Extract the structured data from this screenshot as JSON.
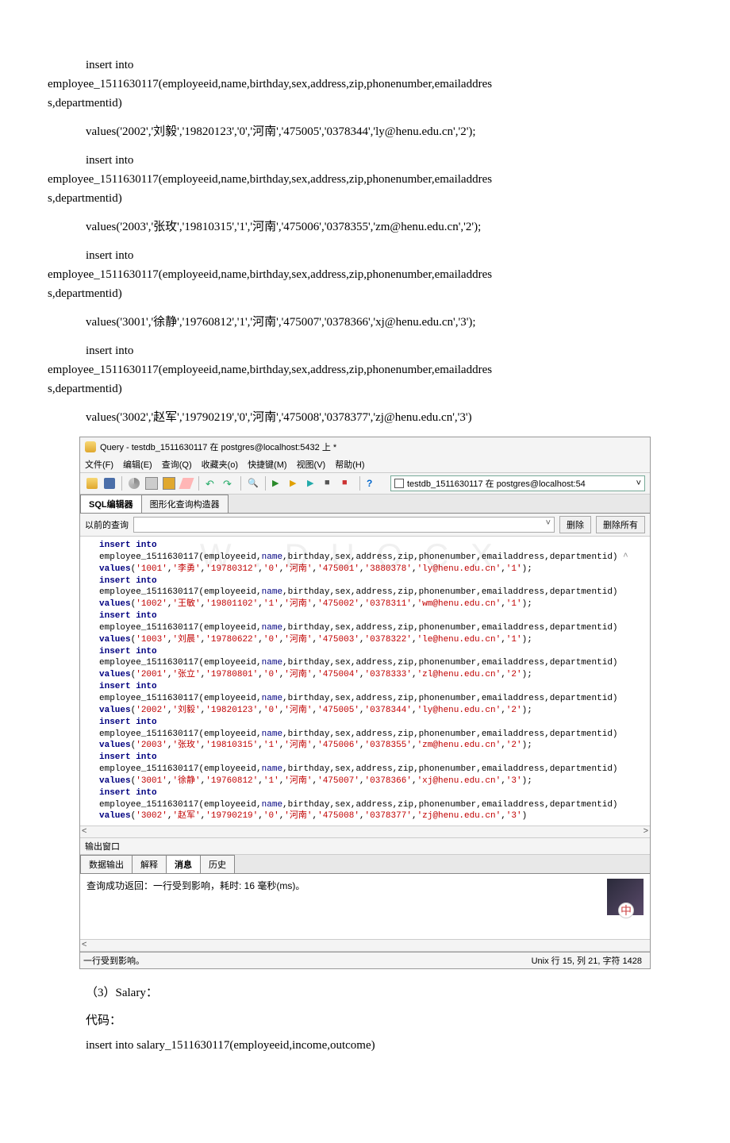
{
  "sql_text": {
    "stmt1": {
      "line1": "insert into",
      "line2": "employee_1511630117(employeeid,name,birthday,sex,address,zip,phonenumber,emailaddres",
      "line3": "s,departmentid)",
      "line4": "values('2002','刘毅','19820123','0','河南','475005','0378344','ly@henu.edu.cn','2');"
    },
    "stmt2": {
      "line1": "insert into",
      "line2": "employee_1511630117(employeeid,name,birthday,sex,address,zip,phonenumber,emailaddres",
      "line3": "s,departmentid)",
      "line4": "values('2003','张玫','19810315','1','河南','475006','0378355','zm@henu.edu.cn','2');"
    },
    "stmt3": {
      "line1": "insert into",
      "line2": "employee_1511630117(employeeid,name,birthday,sex,address,zip,phonenumber,emailaddres",
      "line3": "s,departmentid)",
      "line4": "values('3001','徐静','19760812','1','河南','475007','0378366','xj@henu.edu.cn','3');"
    },
    "stmt4": {
      "line1": "insert into",
      "line2": "employee_1511630117(employeeid,name,birthday,sex,address,zip,phonenumber,emailaddres",
      "line3": "s,departmentid)",
      "line4": "values('3002','赵军','19790219','0','河南','475008','0378377','zj@henu.edu.cn','3')"
    }
  },
  "app": {
    "title": "Query - testdb_1511630117 在 postgres@localhost:5432 上 *",
    "menu": [
      "文件(F)",
      "编辑(E)",
      "查询(Q)",
      "收藏夹(o)",
      "快捷键(M)",
      "视图(V)",
      "帮助(H)"
    ],
    "db_selector": "testdb_1511630117 在 postgres@localhost:54",
    "tabs": {
      "sql": "SQL编辑器",
      "gui": "图形化查询构造器"
    },
    "history_label": "以前的查询",
    "btn_delete": "删除",
    "btn_delete_all": "删除所有",
    "output_label": "输出窗口",
    "out_tabs": {
      "data": "数据输出",
      "explain": "解释",
      "msg": "消息",
      "hist": "历史"
    },
    "msg_text": "查询成功返回：一行受到影响，耗时: 16 毫秒(ms)。",
    "status_left": "一行受到影响。",
    "status_right": "Unix   行 15, 列 21, 字符 1428"
  },
  "editor_rows": [
    {
      "id": "1001",
      "name": "李勇",
      "b": "19780312",
      "s": "0",
      "zip": "475001",
      "ph": "3880378",
      "em": "ly@henu.edu.cn",
      "d": "1"
    },
    {
      "id": "1002",
      "name": "王敏",
      "b": "19801102",
      "s": "1",
      "zip": "475002",
      "ph": "0378311",
      "em": "wm@henu.edu.cn",
      "d": "1"
    },
    {
      "id": "1003",
      "name": "刘晨",
      "b": "19780622",
      "s": "0",
      "zip": "475003",
      "ph": "0378322",
      "em": "le@henu.edu.cn",
      "d": "1"
    },
    {
      "id": "2001",
      "name": "张立",
      "b": "19780801",
      "s": "0",
      "zip": "475004",
      "ph": "0378333",
      "em": "zl@henu.edu.cn",
      "d": "2"
    },
    {
      "id": "2002",
      "name": "刘毅",
      "b": "19820123",
      "s": "0",
      "zip": "475005",
      "ph": "0378344",
      "em": "ly@henu.edu.cn",
      "d": "2"
    },
    {
      "id": "2003",
      "name": "张玫",
      "b": "19810315",
      "s": "1",
      "zip": "475006",
      "ph": "0378355",
      "em": "zm@henu.edu.cn",
      "d": "2"
    },
    {
      "id": "3001",
      "name": "徐静",
      "b": "19760812",
      "s": "1",
      "zip": "475007",
      "ph": "0378366",
      "em": "xj@henu.edu.cn",
      "d": "3"
    },
    {
      "id": "3002",
      "name": "赵军",
      "b": "19790219",
      "s": "0",
      "zip": "475008",
      "ph": "0378377",
      "em": "zj@henu.edu.cn",
      "d": "3"
    }
  ],
  "editor_template": {
    "insert_part": "insert into employee_1511630117(employeeid,name,birthday,sex,address,zip,phonenumber,emailaddress,departmentid)",
    "addr": "河南"
  },
  "post": {
    "p1": "（3）Salary：",
    "p2": "代码：",
    "p3": "insert into salary_1511630117(employeeid,income,outcome)"
  }
}
